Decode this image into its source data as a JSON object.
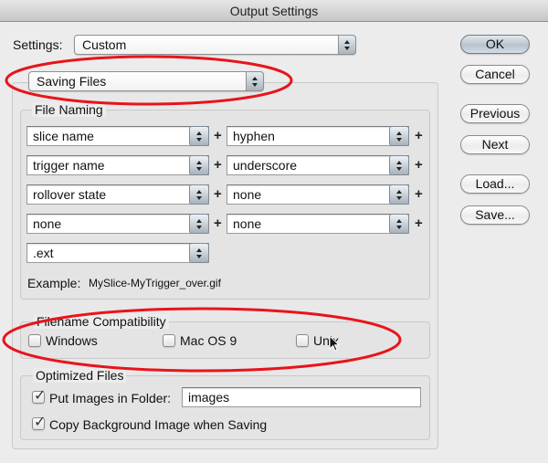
{
  "window": {
    "title": "Output Settings"
  },
  "settings": {
    "label": "Settings:",
    "value": "Custom"
  },
  "section_popup": {
    "value": "Saving Files"
  },
  "buttons": {
    "ok": "OK",
    "cancel": "Cancel",
    "previous": "Previous",
    "next": "Next",
    "load": "Load...",
    "save": "Save..."
  },
  "file_naming": {
    "title": "File Naming",
    "plus": "+",
    "rows": [
      {
        "left": "slice name",
        "right": "hyphen"
      },
      {
        "left": "trigger name",
        "right": "underscore"
      },
      {
        "left": "rollover state",
        "right": "none"
      },
      {
        "left": "none",
        "right": "none"
      }
    ],
    "last": ".ext",
    "example_label": "Example:",
    "example_value": "MySlice-MyTrigger_over.gif"
  },
  "filename_compatibility": {
    "title": "Filename Compatibility",
    "options": [
      {
        "label": "Windows",
        "checked": false
      },
      {
        "label": "Mac OS 9",
        "checked": false
      },
      {
        "label": "Unix",
        "checked": false
      }
    ]
  },
  "optimized_files": {
    "title": "Optimized Files",
    "put_images": {
      "label": "Put Images in Folder:",
      "checked": true,
      "folder": "images"
    },
    "copy_background": {
      "label": "Copy Background Image when Saving",
      "checked": true
    }
  },
  "annotations": {
    "highlight_color": "#e8141b"
  }
}
